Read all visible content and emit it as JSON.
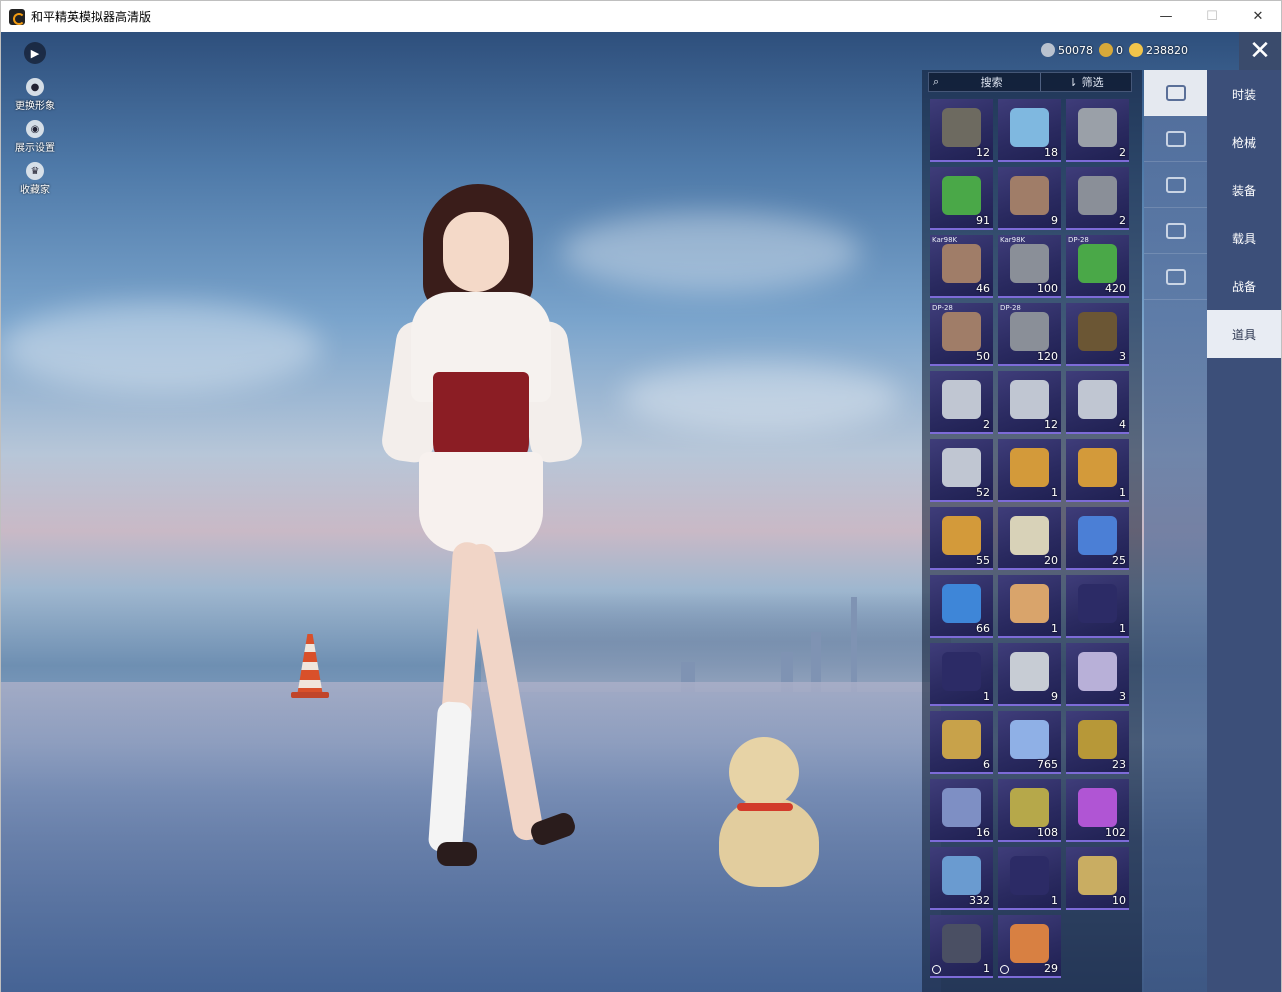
{
  "window": {
    "title": "和平精英模拟器高清版",
    "controls": {
      "minimize": "—",
      "maximize": "☐",
      "close": "✕"
    }
  },
  "hud": {
    "expand_icon": "▶",
    "items": [
      {
        "label": "更换形象",
        "icon": "avatar-icon"
      },
      {
        "label": "展示设置",
        "icon": "eye-icon"
      },
      {
        "label": "收藏家",
        "icon": "collector-icon"
      }
    ]
  },
  "currency": {
    "silver": "50078",
    "gold_coupon": "0",
    "gold": "238820",
    "colors": {
      "silver": "#b9c2cf",
      "gold_coupon": "#d7a93a",
      "gold": "#f2c54b"
    }
  },
  "close_label": "✕",
  "inventory": {
    "search_label": "搜索",
    "filter_label": "筛选",
    "items": [
      {
        "qty": "12",
        "tag": "",
        "color": "#6d6a60",
        "clock": false
      },
      {
        "qty": "18",
        "tag": "",
        "color": "#7fb8e0",
        "clock": false
      },
      {
        "qty": "2",
        "tag": "",
        "color": "#9aa0a8",
        "clock": false
      },
      {
        "qty": "91",
        "tag": "",
        "color": "#4aa848",
        "clock": false
      },
      {
        "qty": "9",
        "tag": "",
        "color": "#a07d68",
        "clock": false
      },
      {
        "qty": "2",
        "tag": "",
        "color": "#8a8f98",
        "clock": false
      },
      {
        "qty": "46",
        "tag": "Kar98K",
        "color": "#a07d68",
        "clock": false
      },
      {
        "qty": "100",
        "tag": "Kar98K",
        "color": "#8a8f98",
        "clock": false
      },
      {
        "qty": "420",
        "tag": "DP-28",
        "color": "#4aa848",
        "clock": false
      },
      {
        "qty": "50",
        "tag": "DP-28",
        "color": "#a07d68",
        "clock": false
      },
      {
        "qty": "120",
        "tag": "DP-28",
        "color": "#8a8f98",
        "clock": false
      },
      {
        "qty": "3",
        "tag": "",
        "color": "#6b5634",
        "clock": false
      },
      {
        "qty": "2",
        "tag": "",
        "color": "#c0c6d2",
        "clock": false
      },
      {
        "qty": "12",
        "tag": "",
        "color": "#c0c6d2",
        "clock": false
      },
      {
        "qty": "4",
        "tag": "",
        "color": "#c0c6d2",
        "clock": false
      },
      {
        "qty": "52",
        "tag": "",
        "color": "#c0c6d2",
        "clock": false
      },
      {
        "qty": "1",
        "tag": "",
        "color": "#d39a3a",
        "clock": false
      },
      {
        "qty": "1",
        "tag": "",
        "color": "#d39a3a",
        "clock": false
      },
      {
        "qty": "55",
        "tag": "",
        "color": "#d39a3a",
        "clock": false
      },
      {
        "qty": "20",
        "tag": "",
        "color": "#d8d2b8",
        "clock": false
      },
      {
        "qty": "25",
        "tag": "",
        "color": "#4b7fd6",
        "clock": false
      },
      {
        "qty": "66",
        "tag": "",
        "color": "#3e86d8",
        "clock": false
      },
      {
        "qty": "1",
        "tag": "",
        "color": "#d9a46b",
        "clock": false
      },
      {
        "qty": "1",
        "tag": "",
        "color": "#2c2b66",
        "clock": false
      },
      {
        "qty": "1",
        "tag": "",
        "color": "#2c2b66",
        "clock": false
      },
      {
        "qty": "9",
        "tag": "",
        "color": "#c7ccd4",
        "clock": false
      },
      {
        "qty": "3",
        "tag": "",
        "color": "#b8b0d8",
        "clock": false
      },
      {
        "qty": "6",
        "tag": "",
        "color": "#c8a24a",
        "clock": false
      },
      {
        "qty": "765",
        "tag": "",
        "color": "#8fb0e6",
        "clock": false
      },
      {
        "qty": "23",
        "tag": "",
        "color": "#b79838",
        "clock": false
      },
      {
        "qty": "16",
        "tag": "",
        "color": "#7e8fc4",
        "clock": false
      },
      {
        "qty": "108",
        "tag": "",
        "color": "#b6a84a",
        "clock": false
      },
      {
        "qty": "102",
        "tag": "",
        "color": "#b055d4",
        "clock": false
      },
      {
        "qty": "332",
        "tag": "",
        "color": "#6a9bd0",
        "clock": false
      },
      {
        "qty": "1",
        "tag": "",
        "color": "#2c2b66",
        "clock": false
      },
      {
        "qty": "10",
        "tag": "",
        "color": "#c9ad62",
        "clock": false
      },
      {
        "qty": "1",
        "tag": "",
        "color": "#4a4f63",
        "clock": true
      },
      {
        "qty": "29",
        "tag": "",
        "color": "#d88042",
        "clock": true
      }
    ]
  },
  "categories": [
    {
      "icon": "card-icon",
      "active": true
    },
    {
      "icon": "calendar-icon",
      "active": false
    },
    {
      "icon": "burst-icon",
      "active": false
    },
    {
      "icon": "ticket-icon",
      "active": false
    },
    {
      "icon": "rifle-icon",
      "active": false
    }
  ],
  "tabs": [
    {
      "label": "时装",
      "active": false
    },
    {
      "label": "枪械",
      "active": false
    },
    {
      "label": "装备",
      "active": false
    },
    {
      "label": "载具",
      "active": false
    },
    {
      "label": "战备",
      "active": false
    },
    {
      "label": "道具",
      "active": true
    }
  ]
}
